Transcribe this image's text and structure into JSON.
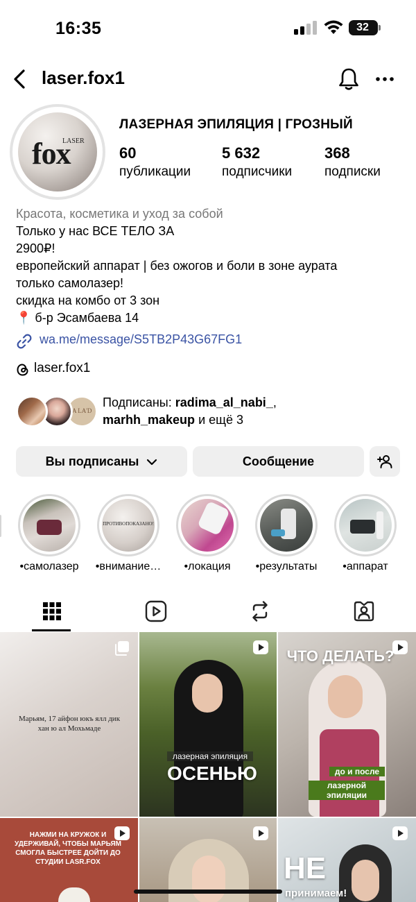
{
  "status_bar": {
    "time": "16:35",
    "battery": "32"
  },
  "header": {
    "username": "laser.fox1"
  },
  "profile": {
    "avatar_logo_small": "LASER",
    "avatar_logo_main": "fox",
    "name": "ЛАЗЕРНАЯ ЭПИЛЯЦИЯ | ГРОЗНЫЙ",
    "stats": [
      {
        "value": "60",
        "label": "публикации"
      },
      {
        "value": "5 632",
        "label": "подписчики"
      },
      {
        "value": "368",
        "label": "подписки"
      }
    ]
  },
  "bio": {
    "category": "Красота, косметика и уход за собой",
    "lines": [
      "Только у нас ВСЕ ТЕЛО ЗА",
      "2900₽!",
      "европейский аппарат | без ожогов и боли в зоне аурата",
      "только самолазер!",
      "скидка на комбо от 3 зон",
      "📍 б-р Эсамбаева 14"
    ],
    "link": "wa.me/message/S5TB2P43G67FG1",
    "threads": "laser.fox1"
  },
  "followed_by": {
    "prefix": "Подписаны: ",
    "user1": "radima_al_nabi_",
    "sep": ",",
    "user2": "marhh_makeup",
    "suffix": " и ещё 3"
  },
  "buttons": {
    "following": "Вы подписаны",
    "message": "Сообщение"
  },
  "highlights": [
    {
      "label": "•самолазер"
    },
    {
      "label": "•внимание…",
      "img_text": "ПРОТИВОПОКАЗАНО!"
    },
    {
      "label": "•локация"
    },
    {
      "label": "•результаты"
    },
    {
      "label": "•аппарат"
    }
  ],
  "grid": {
    "post1_text": "Марьям, 17 айфон юкъ ялл дик хан ю ал Мохьмаде",
    "post2_small": "лазерная эпиляция",
    "post2_big": "ОСЕНЬЮ",
    "post3_top": "ЧТО ДЕЛАТЬ?",
    "post3_tag1": "до и после",
    "post3_tag2": "лазерной эпиляции",
    "post4_text": "НАЖМИ НА КРУЖОК И УДЕРЖИВАЙ, ЧТОБЫ МАРЬЯМ СМОГЛА БЫСТРЕЕ ДОЙТИ ДО СТУДИИ LASR.FOX",
    "post6_big": "НЕ",
    "post6_small": "принимаем!"
  },
  "colors": {
    "link": "#3a53a4",
    "button_bg": "#efefef",
    "secondary_text": "#777777"
  }
}
